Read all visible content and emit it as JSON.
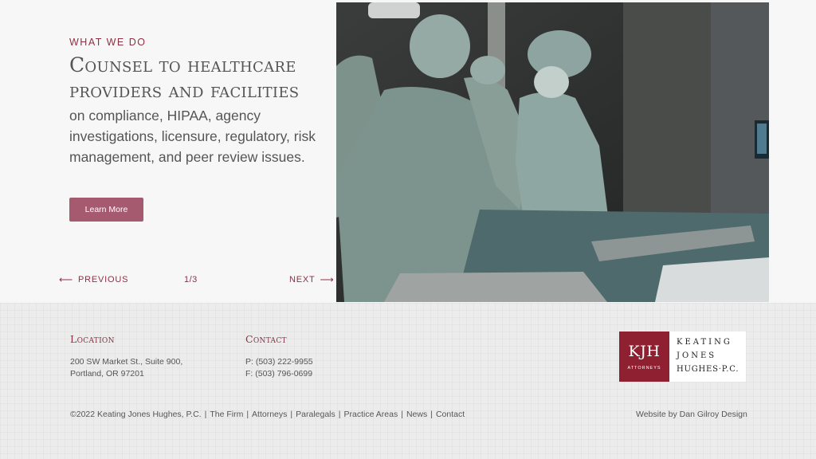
{
  "hero": {
    "eyebrow": "WHAT WE DO",
    "headline": "Counsel to healthcare providers and facilities",
    "subhead": "on compliance, HIPAA, agency investigations, licensure, regulatory, risk management, and peer review issues.",
    "button": "Learn More"
  },
  "slider": {
    "previous": "PREVIOUS",
    "counter": "1/3",
    "next": "NEXT"
  },
  "footer": {
    "location": {
      "heading": "Location",
      "line1": "200 SW Market St., Suite 900,",
      "line2": "Portland, OR 97201"
    },
    "contact": {
      "heading": "Contact",
      "phone": "P: (503) 222-9955",
      "fax": "F: (503) 796-0699"
    },
    "logo": {
      "mark": "KJH",
      "tag": "ATTORNEYS",
      "name1": "KEATING",
      "name2": "JONES",
      "name3": "HUGHES·P.C."
    },
    "copyright": "©2022 Keating Jones Hughes, P.C.",
    "links": [
      "The Firm",
      "Attorneys",
      "Paralegals",
      "Practice Areas",
      "News",
      "Contact"
    ],
    "credit": "Website by Dan Gilroy Design"
  },
  "colors": {
    "accent": "#8e2f44",
    "button": "#a55a6f",
    "logo_bg": "#8e2032"
  },
  "icons": {
    "previous": "arrow-left-icon",
    "next": "arrow-right-icon"
  }
}
